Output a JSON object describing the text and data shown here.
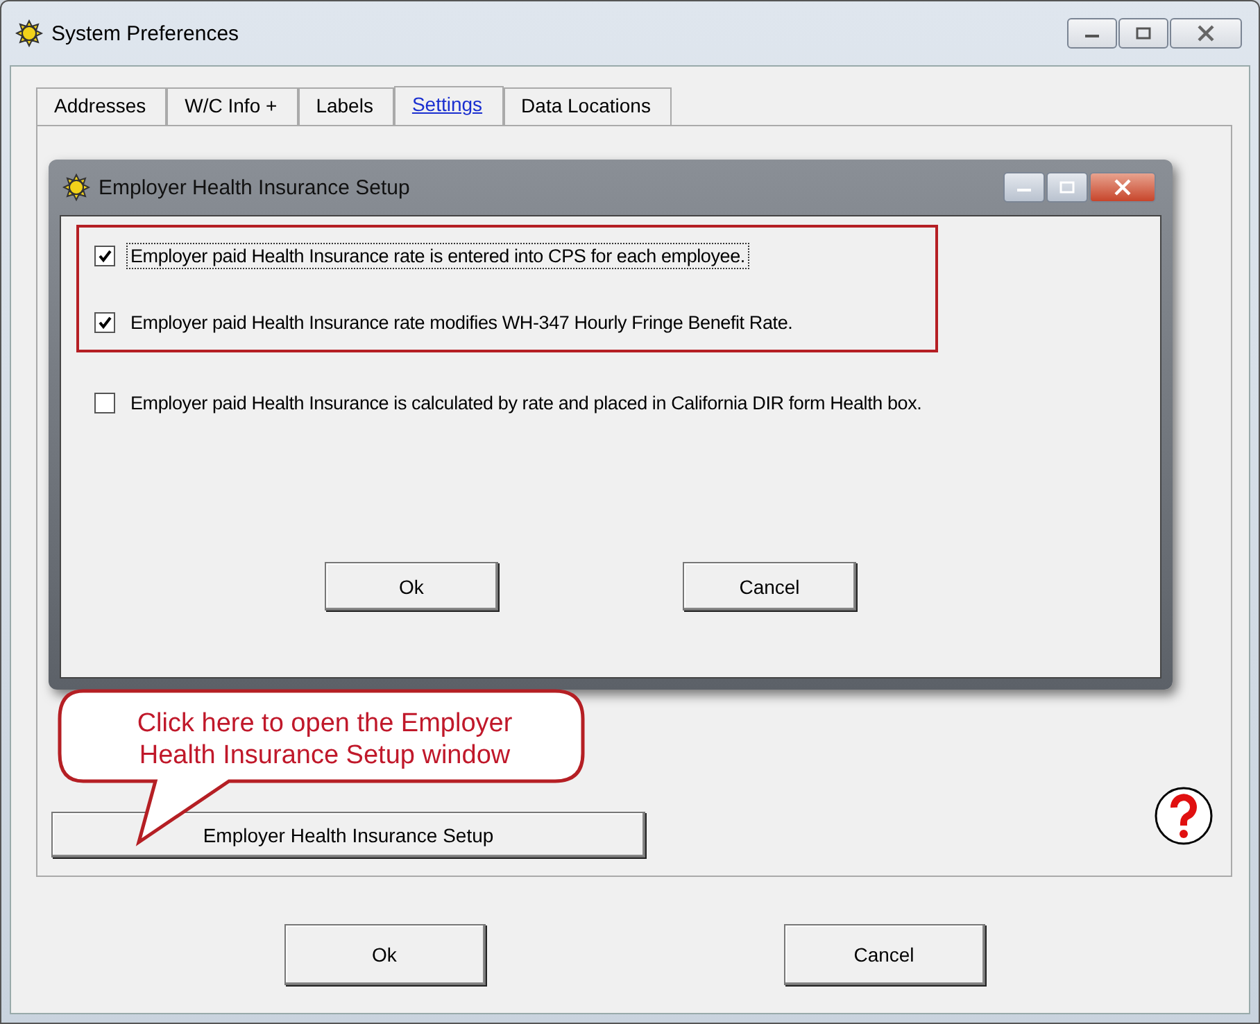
{
  "window": {
    "title": "System Preferences"
  },
  "tabs": [
    {
      "label": "Addresses",
      "selected": false
    },
    {
      "label": "W/C Info +",
      "selected": false
    },
    {
      "label": "Labels",
      "selected": false
    },
    {
      "label": "Settings",
      "selected": true
    },
    {
      "label": "Data Locations",
      "selected": false
    }
  ],
  "setup_button": {
    "label": "Employer Health Insurance Setup"
  },
  "callout": {
    "text": "Click here to open the Employer Health Insurance Setup window"
  },
  "buttons": [
    {
      "label": "Ok"
    },
    {
      "label": "Cancel"
    }
  ],
  "dialog": {
    "title": "Employer Health Insurance Setup",
    "options": [
      {
        "label": "Employer paid Health Insurance rate is entered into CPS for each employee.",
        "checked": true,
        "focused": true,
        "highlighted": true
      },
      {
        "label": "Employer paid Health Insurance rate modifies WH-347 Hourly Fringe Benefit Rate.",
        "checked": true,
        "focused": false,
        "highlighted": true
      },
      {
        "label": "Employer paid Health Insurance is calculated by rate and placed in California DIR form Health box.",
        "checked": false,
        "focused": false,
        "highlighted": false
      }
    ],
    "buttons": [
      {
        "label": "Ok"
      },
      {
        "label": "Cancel"
      }
    ]
  }
}
